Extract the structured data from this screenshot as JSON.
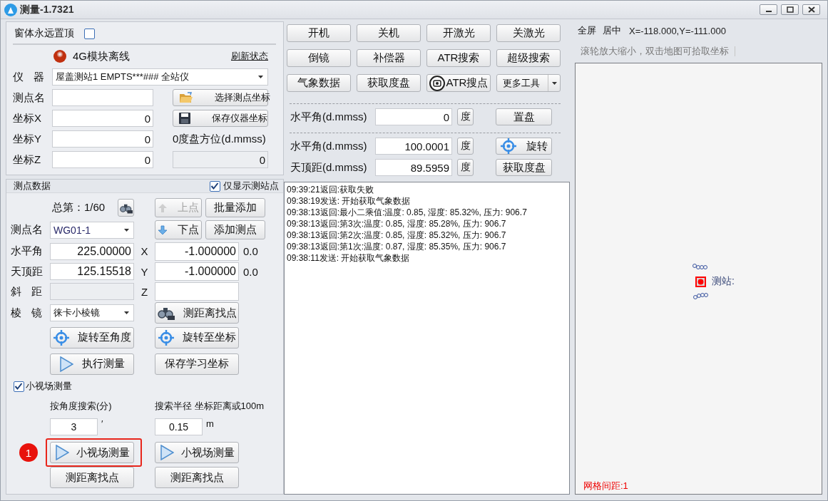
{
  "window": {
    "title": "测量-1.7321"
  },
  "pin_on_top": {
    "label": "窗体永远置顶",
    "checked": false
  },
  "module_status": {
    "label": "4G模块离线",
    "online": false,
    "refresh_link": "刷新状态"
  },
  "station": {
    "instrument": {
      "label": "仪 器",
      "value": "屋盖测站1 EMPTS***### 全站仪"
    },
    "fields": [
      {
        "label": "测点名"
      },
      {
        "label": "坐标X",
        "value": "0"
      },
      {
        "label": "坐标Y",
        "value": "0"
      },
      {
        "label": "坐标Z",
        "value": "0"
      }
    ],
    "buttons": [
      {
        "label": "选择测点坐标",
        "kind": "open"
      },
      {
        "label": "保存仪器坐标",
        "kind": "save"
      }
    ],
    "zero_azimuth": {
      "label": "0度盘方位(d.mmss)",
      "value": "0",
      "disabled": true
    }
  },
  "points": {
    "title": "测点数据",
    "only_stations": {
      "label": "仅显示测站点",
      "checked": true
    },
    "counter": "总第：1/60",
    "prev_button": {
      "label": "上点",
      "disabled": true
    },
    "next_button": {
      "label": "下点",
      "disabled": false
    },
    "batch_add": "批量添加",
    "add_point": "添加测点",
    "name": {
      "label": "测点名",
      "value": "WG01-1"
    },
    "hz": {
      "label": "水平角",
      "value": "225.00000"
    },
    "v": {
      "label": "天顶距",
      "value": "125.15518"
    },
    "sd": {
      "label": "斜 距",
      "disabled": true
    },
    "prism": {
      "label": "棱 镜",
      "value": "徕卡小棱镜"
    },
    "coords": [
      {
        "label": "X",
        "value": "-1.000000",
        "extra": "0.0"
      },
      {
        "label": "Y",
        "value": "-1.000000",
        "extra": "0.0"
      },
      {
        "label": "Z"
      }
    ],
    "actions": [
      {
        "label": "测距离找点",
        "kind": "binoculars"
      },
      {
        "label": "旋转至角度",
        "kind": "aim"
      },
      {
        "label": "旋转至坐标",
        "kind": "aim"
      },
      {
        "label": "执行测量",
        "kind": "run"
      },
      {
        "label": "保存学习坐标",
        "kind": "plain"
      }
    ],
    "small_fov": {
      "label": "小视场测量",
      "checked": true
    },
    "searches": [
      {
        "label": "按角度搜索(分)",
        "value": "3",
        "unit": "′",
        "button": "小视场测量",
        "highlighted": true,
        "badge": "1",
        "find_button": "测距离找点"
      },
      {
        "label": "搜索半径 坐标距离或100m",
        "value": "0.15",
        "unit": "m",
        "button": "小视场测量",
        "highlighted": false,
        "find_button": "测距离找点"
      }
    ]
  },
  "controls": {
    "buttons": [
      {
        "label": "开机",
        "kind": "plain"
      },
      {
        "label": "关机",
        "kind": "plain"
      },
      {
        "label": "开激光",
        "kind": "plain"
      },
      {
        "label": "关激光",
        "kind": "plain"
      },
      {
        "label": "倒镜",
        "kind": "plain"
      },
      {
        "label": "补偿器",
        "kind": "plain"
      },
      {
        "label": "ATR搜索",
        "kind": "plain"
      },
      {
        "label": "超级搜索",
        "kind": "plain"
      },
      {
        "label": "气象数据",
        "kind": "plain"
      },
      {
        "label": "获取度盘",
        "kind": "plain"
      },
      {
        "label": "ATR搜点",
        "kind": "target"
      },
      {
        "label": "更多工具",
        "kind": "dropdown"
      }
    ],
    "set_circle": [
      {
        "label": "水平角(d.mmss)",
        "value": "0",
        "unit_button": "度",
        "action": "置盘",
        "kind": "plain"
      }
    ],
    "turn": [
      {
        "label": "水平角(d.mmss)",
        "value": "100.0001",
        "unit_button": "度",
        "action": "旋转",
        "kind": "aim"
      },
      {
        "label": "天顶距(d.mmss)",
        "value": "89.5959",
        "unit_button": "度",
        "action": "获取度盘",
        "kind": "plain"
      }
    ]
  },
  "log": [
    "09:39:21返回:获取失败",
    "09:38:19发送: 开始获取气象数据",
    "09:38:13返回:最小二乘值:温度: 0.85, 湿度: 85.32%, 压力: 906.7",
    "09:38:13返回:第3次:温度: 0.85, 湿度: 85.28%, 压力: 906.7",
    "09:38:13返回:第2次:温度: 0.85, 湿度: 85.32%, 压力: 906.7",
    "09:38:13返回:第1次:温度: 0.87, 湿度: 85.35%, 压力: 906.7",
    "09:38:11发送: 开始获取气象数据"
  ],
  "map": {
    "toolbar": [
      "全屏",
      "居中"
    ],
    "cursor": "X=-118.000,Y=-111.000",
    "hint": "滚轮放大缩小，双击地图可拾取坐标",
    "station_label": "测站:",
    "grid_spacing": "网格间距:1"
  }
}
